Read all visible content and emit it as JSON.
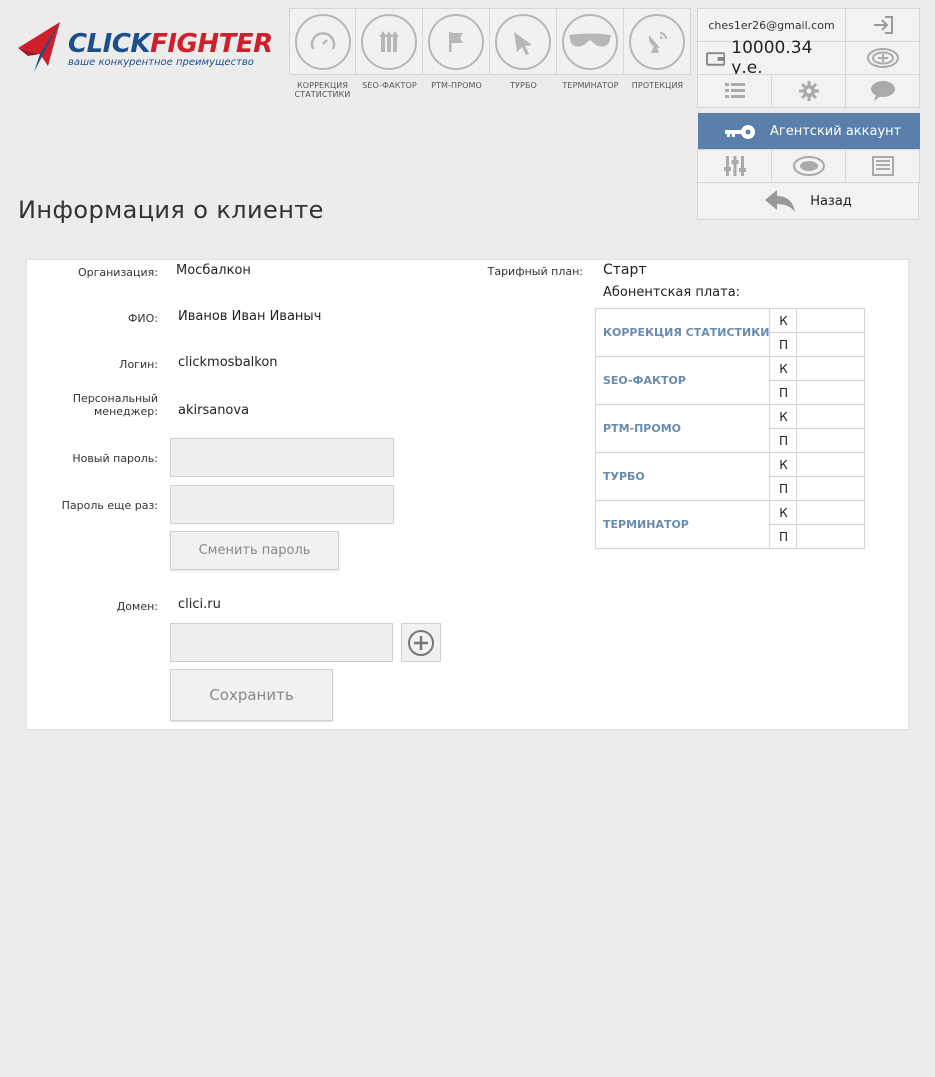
{
  "logo": {
    "brand_part1": "CLICK",
    "brand_part2": "FIGHTER",
    "tagline": "ваше конкурентное преимущество",
    "colors": {
      "primary": "#1b4f8c",
      "accent": "#cf1f2a"
    }
  },
  "nav": {
    "items": [
      {
        "label": "КОРРЕКЦИЯ\nСТАТИСТИКИ",
        "icon": "gauge-icon"
      },
      {
        "label": "SEO-ФАКТОР",
        "icon": "arrows-up-icon"
      },
      {
        "label": "PTM-ПРОМО",
        "icon": "flag-icon"
      },
      {
        "label": "ТУРБО",
        "icon": "cursor-icon"
      },
      {
        "label": "ТЕРМИНАТОР",
        "icon": "sunglasses-icon"
      },
      {
        "label": "ПРОТЕКЦИЯ",
        "icon": "satellite-dish-icon"
      }
    ]
  },
  "account": {
    "email": "ches1er26@gmail.com",
    "balance": "10000.34 у.е.",
    "agent_label": "Агентский аккаунт",
    "back_label": "Назад",
    "colors": {
      "agent_bg": "#5a7faa"
    }
  },
  "page": {
    "title": "Информация о клиенте"
  },
  "form": {
    "organization_label": "Организация:",
    "organization_value": "Мосбалкон",
    "fio_label": "ФИО:",
    "fio_value": "Иванов Иван Иваныч",
    "login_label": "Логин:",
    "login_value": "clickmosbalkon",
    "manager_label_line1": "Персональный",
    "manager_label_line2": "менеджер:",
    "manager_value": "akirsanova",
    "new_password_label": "Новый пароль:",
    "new_password_value": "",
    "repeat_password_label": "Пароль еще раз:",
    "repeat_password_value": "",
    "change_password_button": "Сменить пароль",
    "domain_label": "Домен:",
    "domain_value": "clici.ru",
    "new_domain_value": "",
    "save_button": "Сохранить"
  },
  "plan": {
    "tariff_label": "Тарифный план:",
    "tariff_value": "Старт",
    "fee_label": "Абонентская плата:",
    "rows": [
      {
        "name": "КОРРЕКЦИЯ СТАТИСТИКИ",
        "k": "К",
        "p": "П"
      },
      {
        "name": "SEO-ФАКТОР",
        "k": "К",
        "p": "П"
      },
      {
        "name": "PTM-ПРОМО",
        "k": "К",
        "p": "П"
      },
      {
        "name": "ТУРБО",
        "k": "К",
        "p": "П"
      },
      {
        "name": "ТЕРМИНАТОР",
        "k": "К",
        "p": "П"
      }
    ],
    "colors": {
      "row_name": "#6a8bb1"
    }
  }
}
